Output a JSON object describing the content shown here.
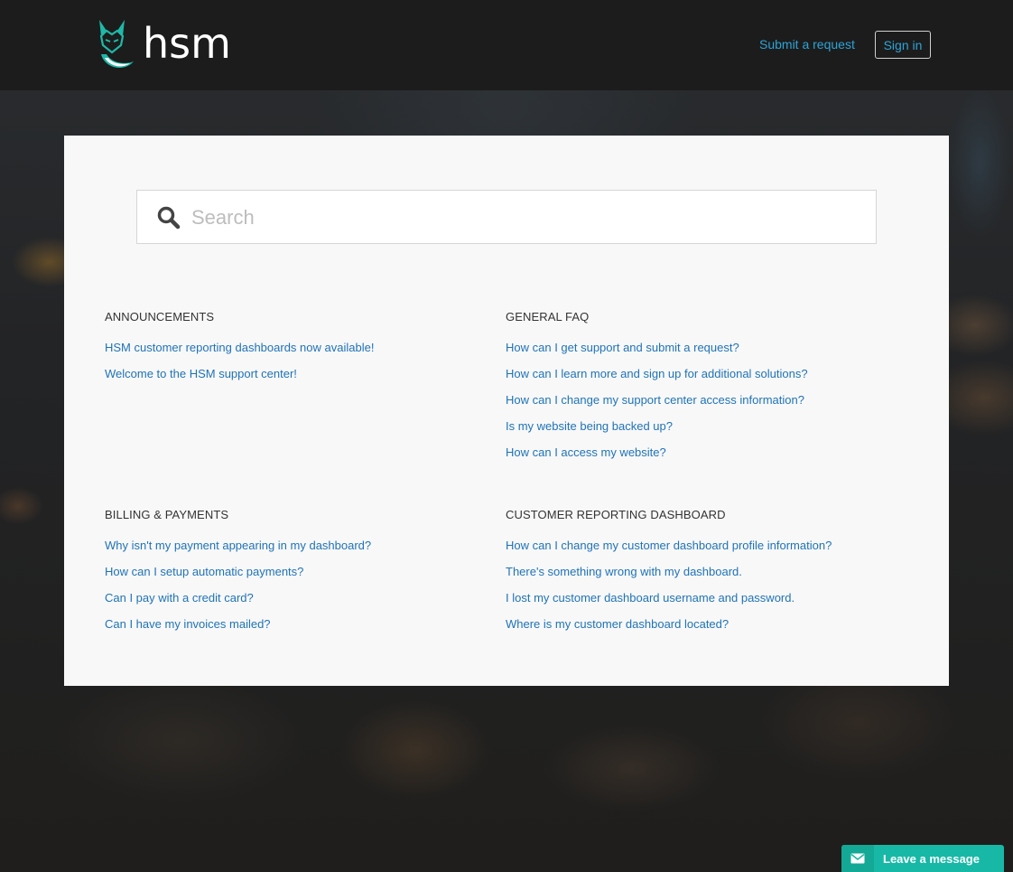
{
  "header": {
    "brand": "hsm",
    "submit_request": "Submit a request",
    "sign_in": "Sign in"
  },
  "search": {
    "placeholder": "Search"
  },
  "sections": [
    {
      "title": "ANNOUNCEMENTS",
      "articles": [
        "HSM customer reporting dashboards now available!",
        "Welcome to the HSM support center!"
      ]
    },
    {
      "title": "GENERAL FAQ",
      "articles": [
        "How can I get support and submit a request?",
        "How can I learn more and sign up for additional solutions?",
        "How can I change my support center access information?",
        "Is my website being backed up?",
        "How can I access my website?"
      ]
    },
    {
      "title": "BILLING & PAYMENTS",
      "articles": [
        "Why isn't my payment appearing in my dashboard?",
        "How can I setup automatic payments?",
        "Can I pay with a credit card?",
        "Can I have my invoices mailed?"
      ]
    },
    {
      "title": "CUSTOMER REPORTING DASHBOARD",
      "articles": [
        "How can I change my customer dashboard profile information?",
        "There's something wrong with my dashboard.",
        "I lost my customer dashboard username and password.",
        "Where is my customer dashboard located?"
      ]
    }
  ],
  "widget": {
    "label": "Leave a message"
  },
  "colors": {
    "accent": "#2ea3d6",
    "link": "#1f73b7",
    "brand_teal": "#17b9a6"
  }
}
